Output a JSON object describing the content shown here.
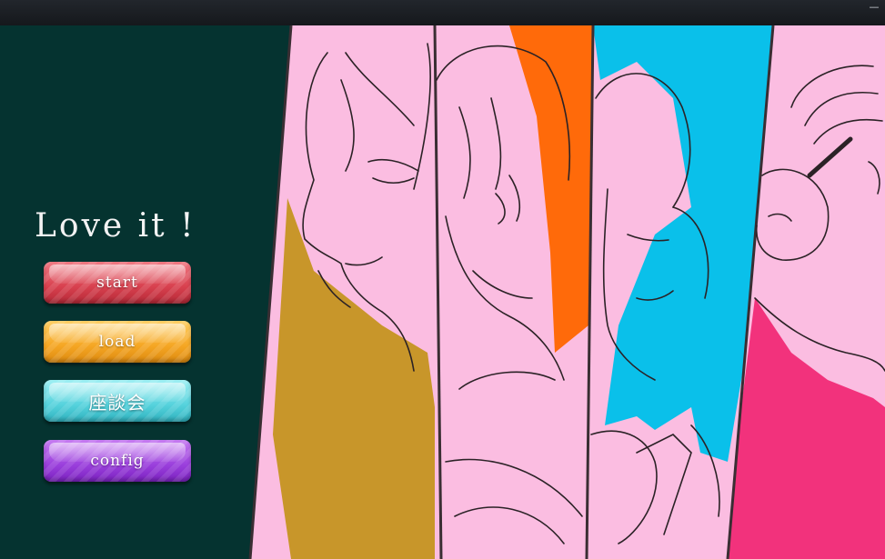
{
  "window": {
    "minimize_glyph": "—"
  },
  "title": {
    "text": "Love it !"
  },
  "menu": {
    "start_label": "start",
    "load_label": "load",
    "talk_label": "座談会",
    "config_label": "config"
  },
  "colors": {
    "background": "#053330",
    "panel_pink": "#fbbde1",
    "ochre": "#c8962a",
    "orange": "#ff6a0a",
    "cyan": "#0ac0ea",
    "magenta": "#f2327c",
    "btn_start": "#d8404e",
    "btn_load": "#f5a623",
    "btn_talk": "#55d2dc",
    "btn_config": "#9a3fdc"
  }
}
